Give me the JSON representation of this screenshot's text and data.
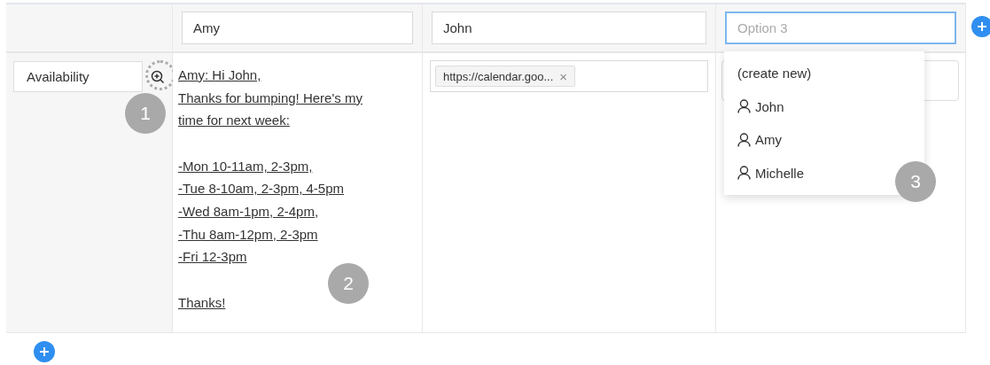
{
  "header_fields": [
    {
      "value": "Amy"
    },
    {
      "value": "John"
    },
    {
      "placeholder": "Option 3",
      "focused": true
    }
  ],
  "row": {
    "label": "Availability",
    "message": [
      [
        "Amy: Hi John,",
        "Thanks for bumping! Here's my",
        "time for next week:"
      ],
      [
        "-Mon 10-11am, 2-3pm,",
        "-Tue 8-10am, 2-3pm, 4-5pm",
        "-Wed 8am-1pm, 2-4pm,",
        "-Thu 8am-12pm, 2-3pm",
        "-Fri 12-3pm"
      ],
      [
        "Thanks!"
      ]
    ],
    "tags": [
      "https://calendar.goo..."
    ],
    "tag_remove": "×"
  },
  "dropdown": {
    "items": [
      {
        "kind": "action",
        "label": "(create new)"
      },
      {
        "kind": "person",
        "label": "John"
      },
      {
        "kind": "person",
        "label": "Amy"
      },
      {
        "kind": "person",
        "label": "Michelle"
      }
    ]
  },
  "callouts": [
    "1",
    "2",
    "3"
  ]
}
